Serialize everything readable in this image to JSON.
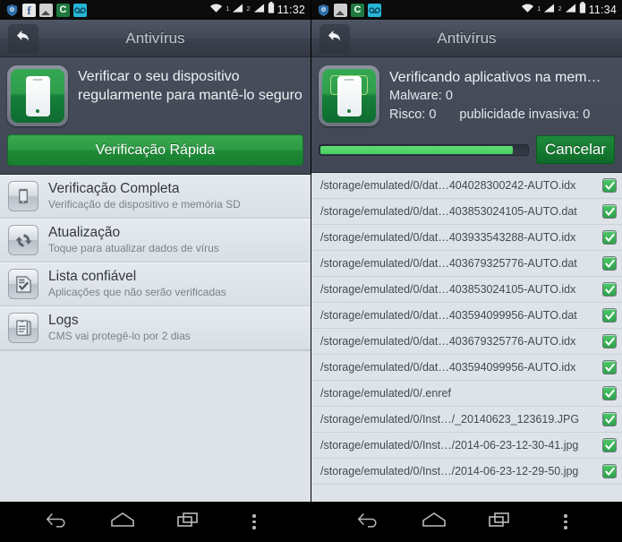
{
  "left_panel": {
    "statusbar": {
      "icons": [
        "shield-icon",
        "facebook-icon",
        "gallery-icon",
        "c-app-icon",
        "voicemail-icon"
      ],
      "sim1_label": "1",
      "sim2_label": "2",
      "time": "11:32"
    },
    "actionbar": {
      "title": "Antivírus",
      "back_icon": "back-arrow-icon"
    },
    "hero": {
      "icon": "phone-scan-icon",
      "message": "Verificar o seu dispositivo regularmente para mantê-lo seguro",
      "quick_scan_label": "Verificação Rápida"
    },
    "menu_items": [
      {
        "icon": "phone-full-scan-icon",
        "title": "Verificação Completa",
        "subtitle": "Verificação de dispositivo e memória SD"
      },
      {
        "icon": "refresh-icon",
        "title": "Atualização",
        "subtitle": "Toque para atualizar dados de vírus"
      },
      {
        "icon": "checklist-icon",
        "title": "Lista confiável",
        "subtitle": "Aplicações que não serão verificadas"
      },
      {
        "icon": "logs-icon",
        "title": "Logs",
        "subtitle": "CMS vai protegê-lo por 2 dias"
      }
    ]
  },
  "right_panel": {
    "statusbar": {
      "icons": [
        "shield-icon",
        "gallery-icon",
        "c-app-icon",
        "voicemail-icon"
      ],
      "sim1_label": "1",
      "sim2_label": "2",
      "time": "11:34"
    },
    "actionbar": {
      "title": "Antivírus",
      "back_icon": "back-arrow-icon"
    },
    "scan": {
      "icon": "phone-scan-icon",
      "status": "Verificando aplicativos na mem…",
      "malware_line": "Malware: 0",
      "risk_label": "Risco: 0",
      "adware_label": "publicidade invasiva: 0",
      "progress_percent": 93,
      "cancel_label": "Cancelar"
    },
    "files": [
      {
        "path": "/storage/emulated/0/dat…404028300242-AUTO.idx",
        "status_icon": "check-icon"
      },
      {
        "path": "/storage/emulated/0/dat…403853024105-AUTO.dat",
        "status_icon": "check-icon"
      },
      {
        "path": "/storage/emulated/0/dat…403933543288-AUTO.idx",
        "status_icon": "check-icon"
      },
      {
        "path": "/storage/emulated/0/dat…403679325776-AUTO.dat",
        "status_icon": "check-icon"
      },
      {
        "path": "/storage/emulated/0/dat…403853024105-AUTO.idx",
        "status_icon": "check-icon"
      },
      {
        "path": "/storage/emulated/0/dat…403594099956-AUTO.dat",
        "status_icon": "check-icon"
      },
      {
        "path": "/storage/emulated/0/dat…403679325776-AUTO.idx",
        "status_icon": "check-icon"
      },
      {
        "path": "/storage/emulated/0/dat…403594099956-AUTO.idx",
        "status_icon": "check-icon"
      },
      {
        "path": "/storage/emulated/0/.enref",
        "status_icon": "check-icon"
      },
      {
        "path": "/storage/emulated/0/Inst…/_20140623_123619.JPG",
        "status_icon": "check-icon"
      },
      {
        "path": "/storage/emulated/0/Inst…/2014-06-23-12-30-41.jpg",
        "status_icon": "check-icon"
      },
      {
        "path": "/storage/emulated/0/Inst…/2014-06-23-12-29-50.jpg",
        "status_icon": "check-icon"
      }
    ]
  },
  "navbar": {
    "back_icon": "nav-back-icon",
    "home_icon": "nav-home-icon",
    "recents_icon": "nav-recents-icon",
    "menu_icon": "nav-overflow-icon"
  },
  "colors": {
    "accent_green": "#2e9a44",
    "progress_green": "#44cf5e",
    "header_dark": "#434957",
    "list_bg": "#dde3e8"
  }
}
